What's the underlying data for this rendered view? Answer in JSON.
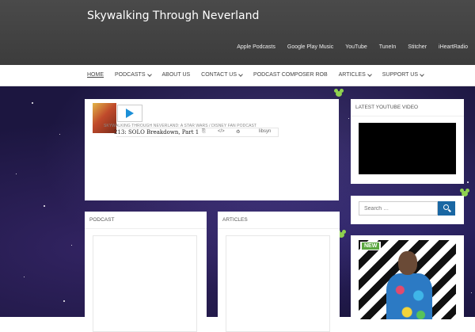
{
  "site": {
    "title": "Skywalking Through Neverland"
  },
  "top_links": [
    "Apple Podcasts",
    "Google Play Music",
    "YouTube",
    "TuneIn",
    "Stitcher",
    "iHeartRadio"
  ],
  "nav": [
    {
      "label": "HOME",
      "active": true,
      "dropdown": false
    },
    {
      "label": "PODCASTS",
      "active": false,
      "dropdown": true
    },
    {
      "label": "ABOUT US",
      "active": false,
      "dropdown": false
    },
    {
      "label": "CONTACT US",
      "active": false,
      "dropdown": true
    },
    {
      "label": "PODCAST COMPOSER ROB",
      "active": false,
      "dropdown": false
    },
    {
      "label": "ARTICLES",
      "active": false,
      "dropdown": true
    },
    {
      "label": "SUPPORT US",
      "active": false,
      "dropdown": true
    }
  ],
  "player": {
    "show_name": "SKYWALKING THROUGH NEVERLAND: A STAR WARS / DISNEY FAN PODCAST",
    "episode_title": "213: SOLO Breakdown, Part 1",
    "share_short": "libsyn"
  },
  "widgets": {
    "youtube_title": "LATEST YOUTUBE VIDEO",
    "search_placeholder": "Search …",
    "podcast_title": "PODCAST",
    "articles_title": "ARTICLES",
    "new_badge": "NEW"
  },
  "colors": {
    "accent": "#1a67a3",
    "play": "#1b8fd7",
    "badge": "#5aa63f"
  }
}
